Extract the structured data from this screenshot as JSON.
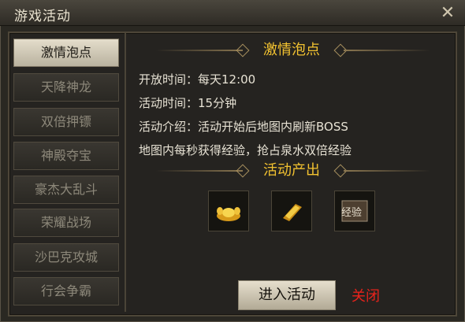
{
  "window": {
    "title": "游戏活动",
    "close_glyph": "✕"
  },
  "sidebar": {
    "items": [
      {
        "label": "激情泡点",
        "active": true
      },
      {
        "label": "天降神龙",
        "active": false
      },
      {
        "label": "双倍押镖",
        "active": false
      },
      {
        "label": "神殿夺宝",
        "active": false
      },
      {
        "label": "豪杰大乱斗",
        "active": false
      },
      {
        "label": "荣耀战场",
        "active": false
      },
      {
        "label": "沙巴克攻城",
        "active": false
      },
      {
        "label": "行会争霸",
        "active": false
      }
    ]
  },
  "detail": {
    "title": "激情泡点",
    "open_time": "开放时间：每天12:00",
    "duration": "活动时间：15分钟",
    "intro_line1": "活动介绍：活动开始后地图内刷新BOSS",
    "intro_line2": "地图内每秒获得经验，抢占泉水双倍经验",
    "rewards_title": "活动产出",
    "rewards": [
      {
        "icon": "gold-ingot-icon"
      },
      {
        "icon": "gold-bar-icon"
      },
      {
        "icon": "exp-scroll-icon",
        "label": "经验"
      }
    ]
  },
  "actions": {
    "enter_label": "进入活动",
    "close_label": "关闭"
  },
  "colors": {
    "title_gold": "#f2c230",
    "close_red": "#e8231b"
  }
}
